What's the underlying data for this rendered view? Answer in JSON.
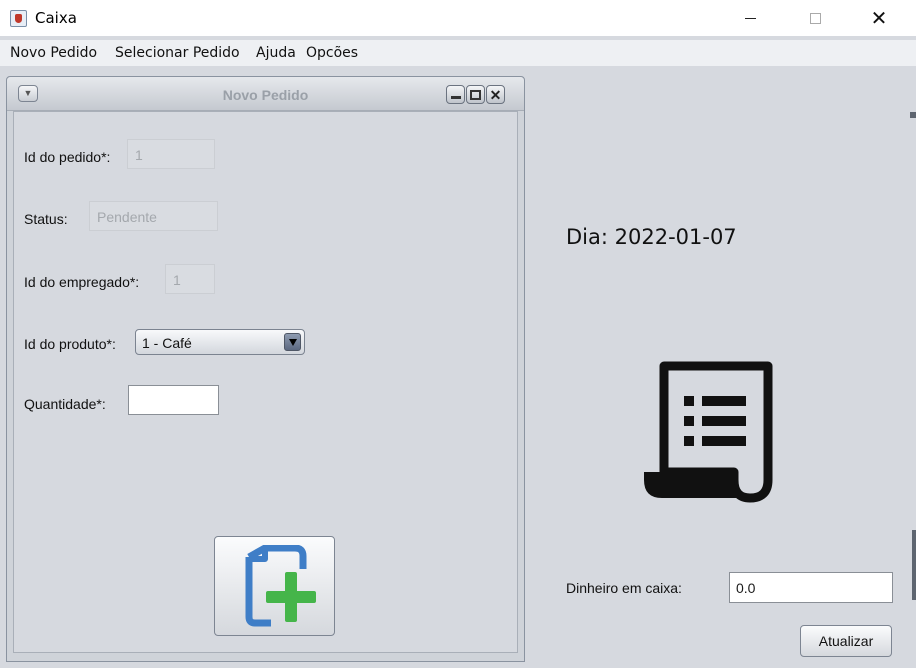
{
  "window": {
    "title": "Caixa",
    "icon": "java-cup-icon"
  },
  "menubar": {
    "items": [
      "Novo Pedido",
      "Selecionar Pedido",
      "Ajuda",
      "Opcões"
    ]
  },
  "internal_frame": {
    "title": "Novo Pedido",
    "form": {
      "order_id": {
        "label": "Id do pedido*:",
        "value": "1"
      },
      "status": {
        "label": "Status:",
        "value": "Pendente"
      },
      "employee_id": {
        "label": "Id do empregado*:",
        "value": "1"
      },
      "product_id": {
        "label": "Id do produto*:",
        "selected": "1 - Café"
      },
      "quantity": {
        "label": "Quantidade*:",
        "value": ""
      }
    },
    "add_button_icon": "add-document-icon"
  },
  "side_panel": {
    "day": "Dia: 2022-01-07",
    "receipt_icon": "receipt-icon",
    "cash": {
      "label": "Dinheiro em caixa:",
      "value": "0.0"
    },
    "update_label": "Atualizar"
  },
  "colors": {
    "add_icon_blue": "#3f7ec7",
    "add_icon_green": "#45b54a",
    "background": "#d6d9df"
  }
}
